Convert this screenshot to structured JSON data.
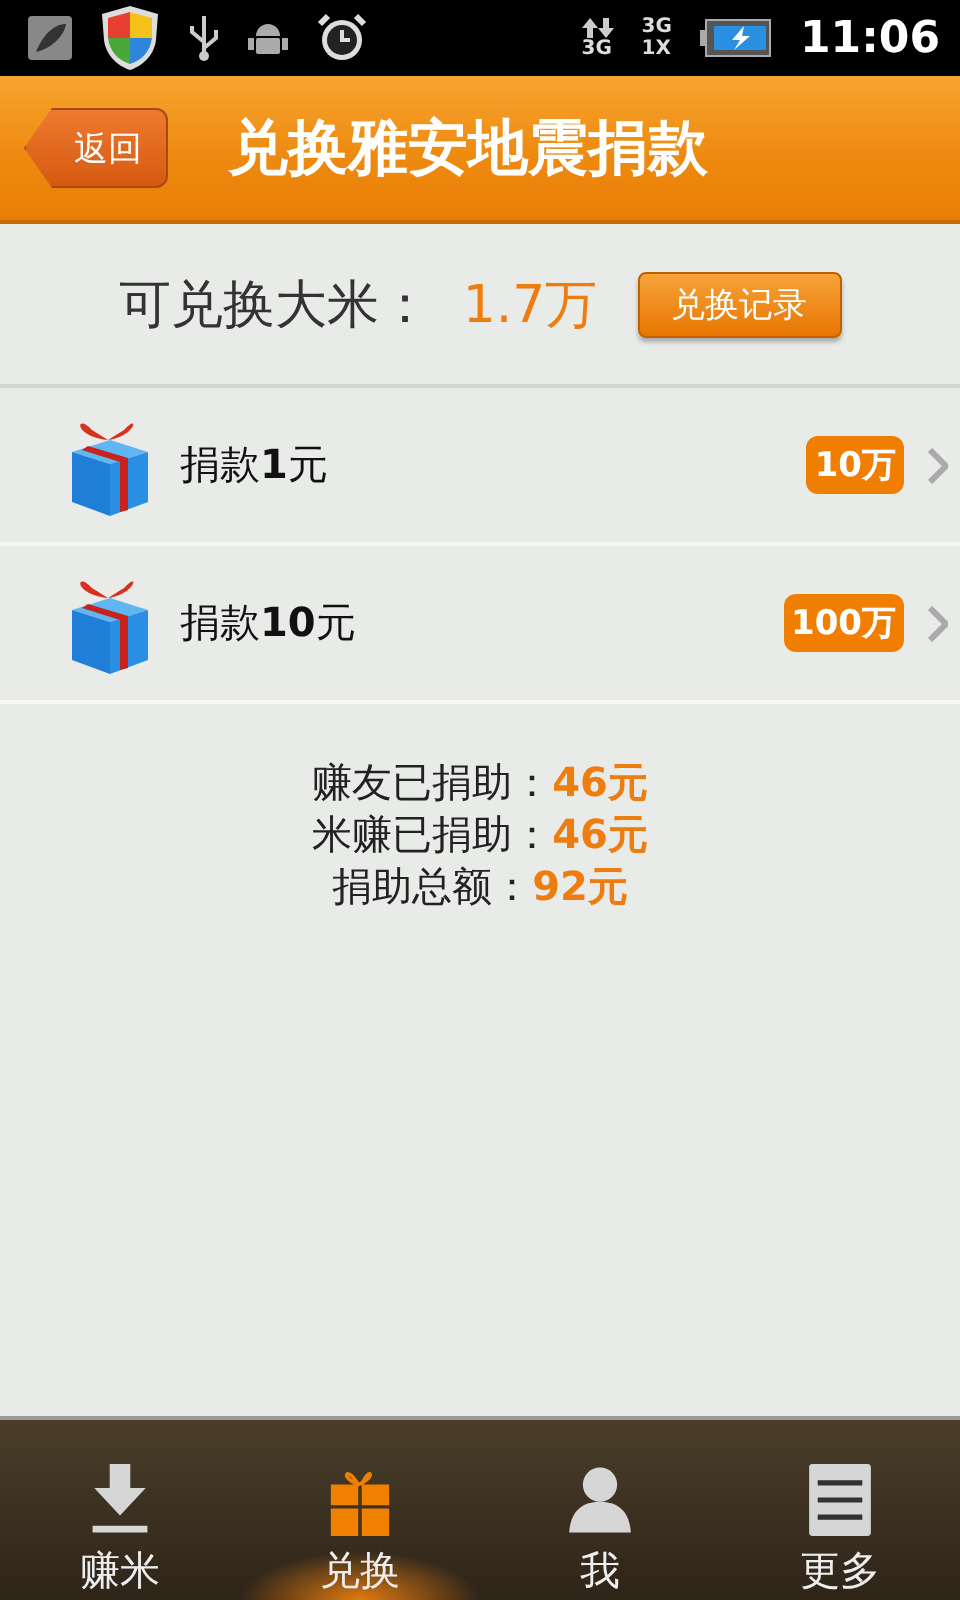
{
  "status_bar": {
    "data_network": "3G",
    "signal_1": "3G",
    "signal_2": "1X",
    "time": "11:06"
  },
  "header": {
    "back": "返回",
    "title": "兑换雅安地震捐款"
  },
  "summary": {
    "label": "可兑换大米：",
    "amount": "1.7万",
    "record_button": "兑换记录"
  },
  "items": [
    {
      "name": "捐款**1**元",
      "cost": "10万"
    },
    {
      "name": "捐款**10**元",
      "cost": "100万"
    }
  ],
  "totals": [
    {
      "label": "赚友已捐助：",
      "value": "46元"
    },
    {
      "label": "米赚已捐助：",
      "value": "46元"
    },
    {
      "label": "捐助总额：",
      "value": "92元"
    }
  ],
  "tabs": [
    {
      "label": "赚米",
      "kind": "download",
      "selected": false
    },
    {
      "label": "兑换",
      "kind": "gift",
      "selected": true
    },
    {
      "label": "我",
      "kind": "person",
      "selected": false
    },
    {
      "label": "更多",
      "kind": "list",
      "selected": false
    }
  ]
}
